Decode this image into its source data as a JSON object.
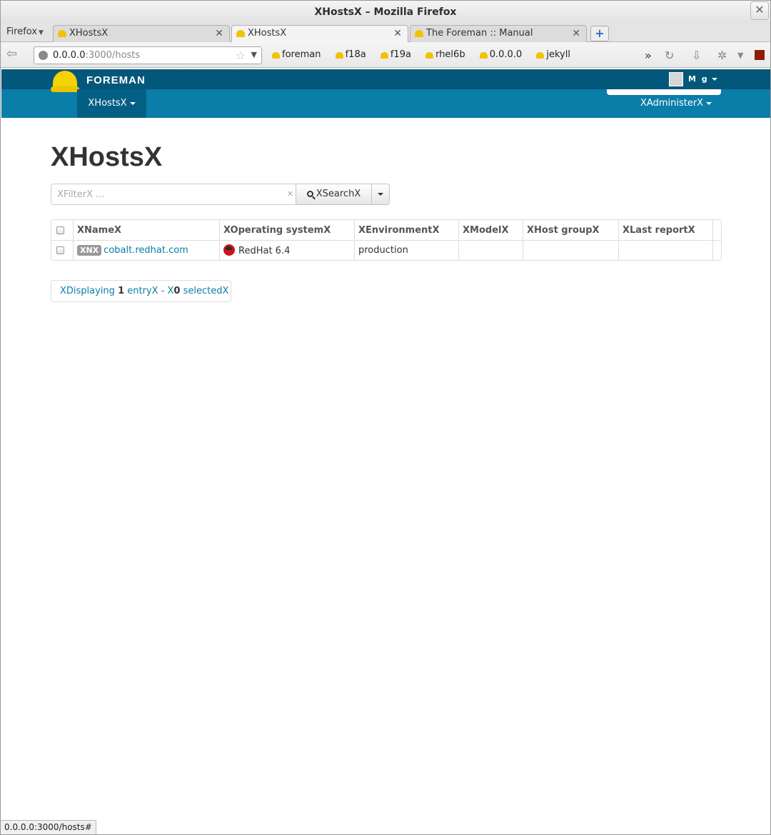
{
  "window": {
    "title": "XHostsX – Mozilla Firefox"
  },
  "firefox_menu": "Firefox",
  "tabs": [
    {
      "label": "XHostsX",
      "active": false
    },
    {
      "label": "XHostsX",
      "active": true
    },
    {
      "label": "The Foreman :: Manual",
      "active": false
    }
  ],
  "urlbar": {
    "host": "0.0.0.0",
    "path": ":3000/hosts"
  },
  "bookmarks": [
    "foreman",
    "f18a",
    "f19a",
    "rhel6b",
    "0.0.0.0",
    "jekyll"
  ],
  "overflow": "»",
  "foreman": {
    "brand": "FOREMAN",
    "user": "M g",
    "hosts_menu": "XHostsX",
    "admin_menu": "XAdministerX"
  },
  "page": {
    "title": "XHostsX",
    "search": {
      "placeholder": "XFilterX ...",
      "button": "XSearchX"
    },
    "table": {
      "headers": [
        "XNameX",
        "XOperating systemX",
        "XEnvironmentX",
        "XModelX",
        "XHost groupX",
        "XLast reportX"
      ],
      "rows": [
        {
          "badge": "XNX",
          "name": "cobalt.redhat.com",
          "os": "RedHat 6.4",
          "environment": "production",
          "model": "",
          "hostgroup": "",
          "last_report": ""
        }
      ]
    },
    "pager": {
      "prefix": "XDisplaying ",
      "count": "1",
      "mid": " entryX - X",
      "selected": "0",
      "suffix": " selectedX"
    }
  },
  "statusbar": "0.0.0.0:3000/hosts#"
}
